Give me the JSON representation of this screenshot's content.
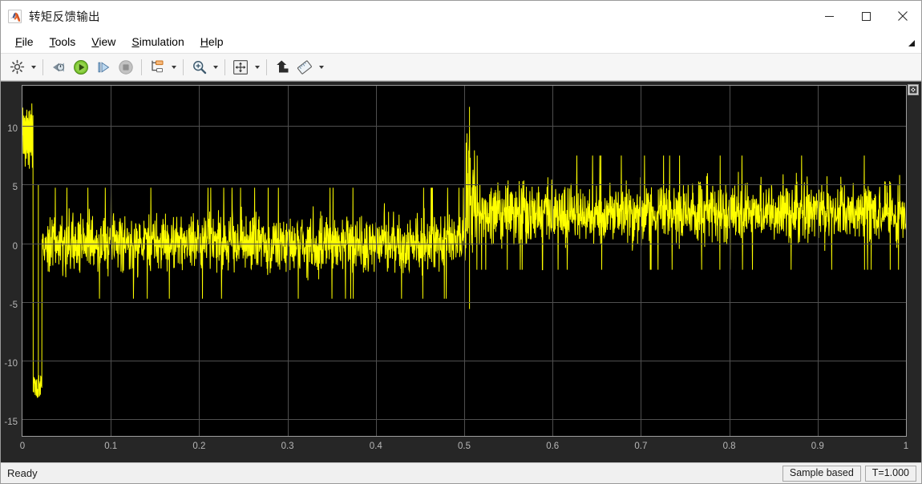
{
  "window": {
    "title": "转矩反馈输出",
    "app_icon": "matlab-icon",
    "minimize_label": "Minimize",
    "maximize_label": "Maximize",
    "close_label": "Close"
  },
  "menubar": {
    "items": [
      {
        "label": "File",
        "mnemonic": "F"
      },
      {
        "label": "Tools",
        "mnemonic": "T"
      },
      {
        "label": "View",
        "mnemonic": "V"
      },
      {
        "label": "Simulation",
        "mnemonic": "S"
      },
      {
        "label": "Help",
        "mnemonic": "H"
      }
    ],
    "overflow_icon": "menu-overflow-arrow-icon"
  },
  "toolbar": {
    "buttons": [
      {
        "name": "configuration-properties-button",
        "icon": "gear-icon",
        "has_caret": true,
        "enabled": true
      },
      {
        "name": "back-to-start-button",
        "icon": "rewind-icon",
        "has_caret": false,
        "enabled": true
      },
      {
        "name": "run-button",
        "icon": "play-icon",
        "has_caret": false,
        "enabled": true
      },
      {
        "name": "step-forward-button",
        "icon": "step-forward-icon",
        "has_caret": false,
        "enabled": true
      },
      {
        "name": "stop-button",
        "icon": "stop-icon",
        "has_caret": false,
        "enabled": false
      },
      {
        "name": "signal-selection-button",
        "icon": "signal-selection-icon",
        "has_caret": true,
        "enabled": true
      },
      {
        "name": "zoom-button",
        "icon": "magnifier-icon",
        "has_caret": true,
        "enabled": true
      },
      {
        "name": "autoscale-button",
        "icon": "autoscale-icon",
        "has_caret": true,
        "enabled": true
      },
      {
        "name": "cursor-measurements-button",
        "icon": "data-cursor-icon",
        "has_caret": false,
        "enabled": true
      },
      {
        "name": "measurements-button",
        "icon": "ruler-icon",
        "has_caret": true,
        "enabled": true
      }
    ]
  },
  "scope": {
    "maximize_chip_icon": "expand-axes-icon",
    "background_color": "#000000",
    "surround_color": "#262626",
    "grid_color": "#4f4f4f",
    "trace_color": "#ffff00"
  },
  "statusbar": {
    "ready_text": "Ready",
    "mode_text": "Sample based",
    "time_text": "T=1.000"
  },
  "chart_data": {
    "type": "line",
    "title": "",
    "xlabel": "",
    "ylabel": "",
    "xlim": [
      0,
      1
    ],
    "ylim": [
      -16.4,
      13.4
    ],
    "xticks": [
      0,
      0.1,
      0.2,
      0.3,
      0.4,
      0.5,
      0.6,
      0.7,
      0.8,
      0.9,
      1
    ],
    "xtick_labels": [
      "0",
      "0.1",
      "0.2",
      "0.3",
      "0.4",
      "0.5",
      "0.6",
      "0.7",
      "0.8",
      "0.9",
      "1"
    ],
    "yticks": [
      10,
      5,
      0,
      -5,
      -10,
      -15
    ],
    "ytick_labels": [
      "10",
      "5",
      "0",
      "-5",
      "-10",
      "-15"
    ],
    "grid": true,
    "legend": "none",
    "series": [
      {
        "name": "torque feedback",
        "color": "#ffff00",
        "description": "Noisy torque feedback signal sampled over t = 0 to 1 s",
        "segments": [
          {
            "t_start": 0.0,
            "t_end": 0.012,
            "mean": 9.0,
            "amplitude": 3.0,
            "note": "startup positive transient peaking near 12"
          },
          {
            "t_start": 0.012,
            "t_end": 0.022,
            "mean": -11.0,
            "amplitude": 2.5,
            "note": "startup negative spike reaching about -13"
          },
          {
            "t_start": 0.022,
            "t_end": 0.502,
            "mean": 0.0,
            "amplitude": 3.5,
            "note": "steady-state noise band roughly -4 to +4"
          },
          {
            "t_start": 0.502,
            "t_end": 0.512,
            "mean": 4.0,
            "amplitude": 7.5,
            "note": "step transient spiking to about +11.5 and -5.5"
          },
          {
            "t_start": 0.512,
            "t_end": 1.0,
            "mean": 2.6,
            "amplitude": 3.6,
            "note": "elevated noise band roughly -1 to +6.5"
          }
        ]
      }
    ]
  }
}
